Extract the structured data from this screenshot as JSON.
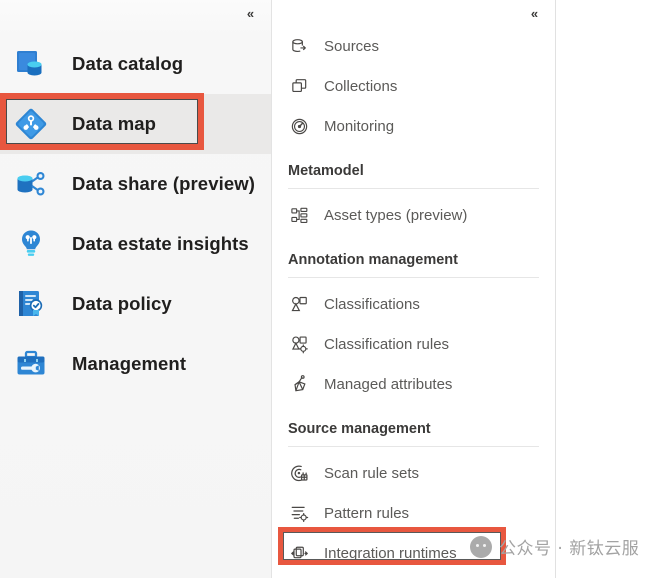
{
  "window": {
    "background": "#ffffff",
    "highlight_color": "#e8573f",
    "accent_blue": "#0f76bc",
    "selected_row_bg": "#eae9e8"
  },
  "primary_nav": {
    "collapse_label": "«",
    "items": [
      {
        "label": "Data catalog",
        "icon": "data-catalog-icon",
        "selected": false
      },
      {
        "label": "Data map",
        "icon": "data-map-icon",
        "selected": true,
        "highlighted": true
      },
      {
        "label": "Data share (preview)",
        "icon": "data-share-icon",
        "selected": false
      },
      {
        "label": "Data estate insights",
        "icon": "data-estate-insights-icon",
        "selected": false
      },
      {
        "label": "Data policy",
        "icon": "data-policy-icon",
        "selected": false
      },
      {
        "label": "Management",
        "icon": "management-icon",
        "selected": false
      }
    ]
  },
  "secondary_nav": {
    "collapse_label": "«",
    "entries": [
      {
        "type": "item",
        "label": "Sources",
        "icon": "sources-icon"
      },
      {
        "type": "item",
        "label": "Collections",
        "icon": "collections-icon"
      },
      {
        "type": "item",
        "label": "Monitoring",
        "icon": "monitoring-icon"
      },
      {
        "type": "group",
        "label": "Metamodel"
      },
      {
        "type": "item",
        "label": "Asset types (preview)",
        "icon": "asset-types-icon"
      },
      {
        "type": "group",
        "label": "Annotation management"
      },
      {
        "type": "item",
        "label": "Classifications",
        "icon": "classifications-icon"
      },
      {
        "type": "item",
        "label": "Classification rules",
        "icon": "classification-rules-icon"
      },
      {
        "type": "item",
        "label": "Managed attributes",
        "icon": "managed-attributes-icon"
      },
      {
        "type": "group",
        "label": "Source management"
      },
      {
        "type": "item",
        "label": "Scan rule sets",
        "icon": "scan-rule-sets-icon"
      },
      {
        "type": "item",
        "label": "Pattern rules",
        "icon": "pattern-rules-icon"
      },
      {
        "type": "item",
        "label": "Integration runtimes",
        "icon": "integration-runtimes-icon",
        "highlighted": true
      }
    ]
  },
  "watermark": {
    "text": "公众号 · 新钛云服",
    "logo": "wechat-icon"
  }
}
